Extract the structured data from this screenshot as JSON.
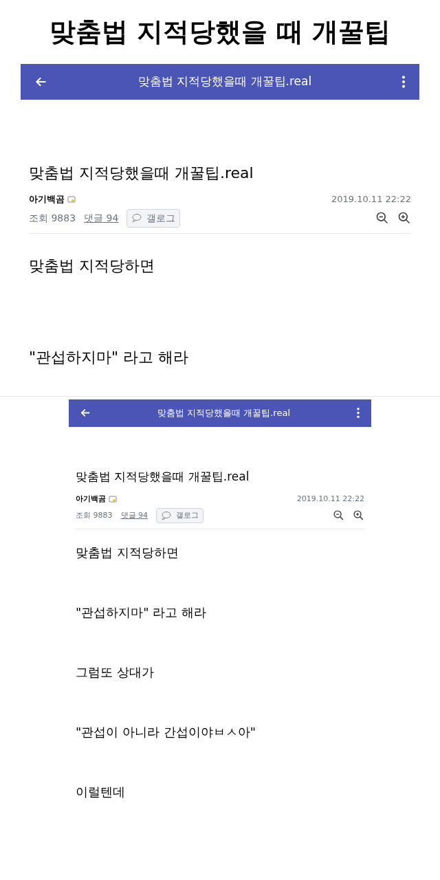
{
  "headline": "맞춤법 지적당했을 때 개꿀팁",
  "screenshots": [
    {
      "kind": "large",
      "appbar_title": "맞춤법 지적당했을때 개꿀팁.real",
      "post_title": "맞춤법 지적당했을때 개꿀팁.real",
      "author": "아기백곰",
      "datetime": "2019.10.11 22:22",
      "views": "조회 9883",
      "comments": "댓글 94",
      "badge": "갤로그",
      "body": [
        "맞춤법 지적당하면",
        "\"관섭하지마\" 라고 해라"
      ]
    },
    {
      "kind": "small",
      "appbar_title": "맞춤법 지적당했을때 개꿀팁.real",
      "post_title": "맞춤법 지적당했을때 개꿀팁.real",
      "author": "아기백곰",
      "datetime": "2019.10.11 22:22",
      "views": "조회 9883",
      "comments": "댓글 94",
      "badge": "갤로그",
      "body": [
        "맞춤법 지적당하면",
        "\"관섭하지마\" 라고 해라",
        "그럼또 상대가",
        "\"관섭이 아니라 간섭이야ㅂㅅ아\"",
        "이럴텐데"
      ]
    }
  ]
}
